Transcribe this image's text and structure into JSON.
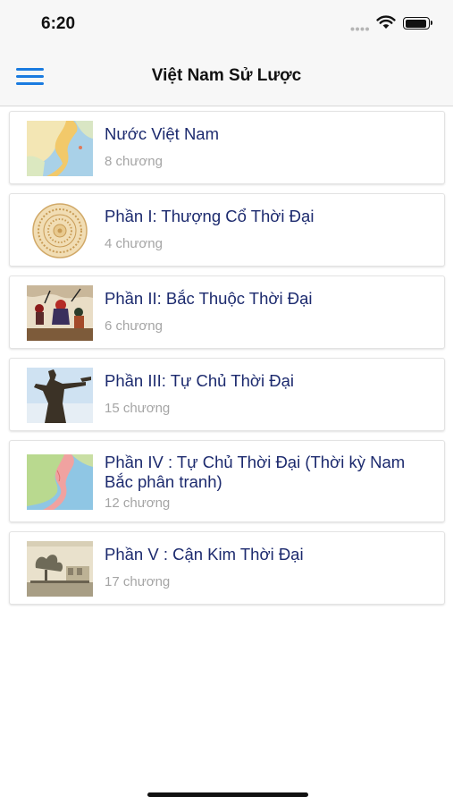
{
  "status_bar": {
    "time": "6:20"
  },
  "navbar": {
    "title": "Việt Nam Sử Lược"
  },
  "items": [
    {
      "title": "Nước Việt Nam",
      "subtitle": "8 chương",
      "thumb": "map-of-vietnam"
    },
    {
      "title": "Phần I: Thượng Cổ Thời Đại",
      "subtitle": "4 chương",
      "thumb": "bronze-drum-pattern"
    },
    {
      "title": "Phần II: Bắc Thuộc Thời Đại",
      "subtitle": "6 chương",
      "thumb": "battle-painting"
    },
    {
      "title": "Phần III: Tự Chủ Thời Đại",
      "subtitle": "15 chương",
      "thumb": "warrior-statue"
    },
    {
      "title": "Phần IV : Tự Chủ Thời Đại (Thời kỳ Nam Bắc phân tranh)",
      "subtitle": "12 chương",
      "thumb": "historical-map"
    },
    {
      "title": "Phần V : Cận Kim Thời Đại",
      "subtitle": "17 chương",
      "thumb": "old-photograph"
    }
  ]
}
